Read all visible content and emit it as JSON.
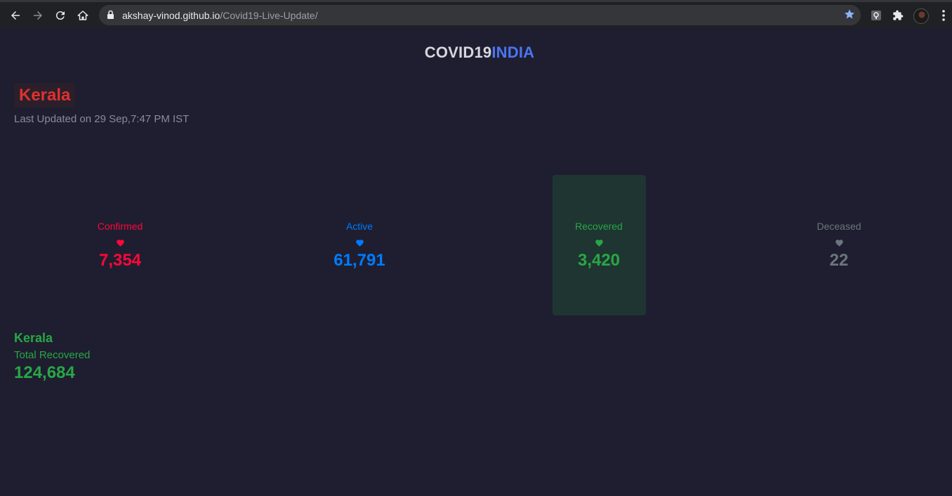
{
  "browser": {
    "url_host": "akshay-vinod.github.io",
    "url_path": "/Covid19-Live-Update/"
  },
  "brand": {
    "part1": "COVID19",
    "part2": "INDIA"
  },
  "state": {
    "name": "Kerala",
    "last_updated": "Last Updated on 29 Sep,7:47 PM IST"
  },
  "stats": [
    {
      "label": "Confirmed",
      "value": "7,354",
      "color": "#ff073a"
    },
    {
      "label": "Active",
      "value": "61,791",
      "color": "#007bff"
    },
    {
      "label": "Recovered",
      "value": "3,420",
      "color": "#28a745"
    },
    {
      "label": "Deceased",
      "value": "22",
      "color": "#6c757d"
    }
  ],
  "summary": {
    "state": "Kerala",
    "label": "Total Recovered",
    "value": "124,684"
  },
  "icons": [
    "back-icon",
    "forward-icon",
    "reload-icon",
    "home-icon",
    "lock-icon",
    "star-icon",
    "extension-icon",
    "puzzle-icon",
    "menu-icon",
    "heart-icon"
  ]
}
